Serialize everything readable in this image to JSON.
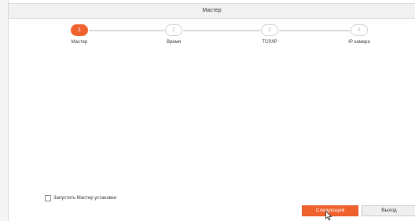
{
  "window": {
    "title": "Мастер"
  },
  "wizard": {
    "steps": [
      {
        "number": "1",
        "label": "Мастер",
        "active": true
      },
      {
        "number": "2",
        "label": "Время",
        "active": false
      },
      {
        "number": "3",
        "label": "TCP/IP",
        "active": false
      },
      {
        "number": "4",
        "label": "IP камера",
        "active": false
      }
    ]
  },
  "footer": {
    "checkbox_label": "Запустить Мастер установки",
    "checkbox_checked": false,
    "next_label": "Следующий",
    "exit_label": "Выход"
  },
  "colors": {
    "accent": "#f0622d",
    "inactive_step": "#cfcfcf"
  }
}
